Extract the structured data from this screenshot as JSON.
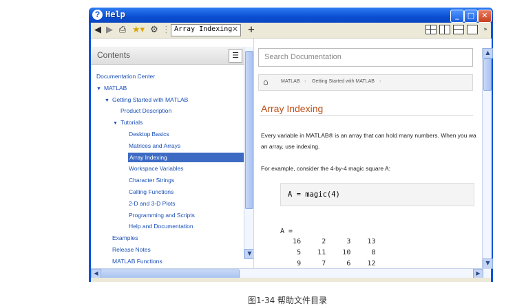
{
  "window": {
    "title": "Help",
    "title_icon": "?",
    "controls": {
      "minimize": "_",
      "maximize": "□",
      "close": "✕"
    }
  },
  "toolbar": {
    "tab_label": "Array Indexing",
    "tab_close": "✕",
    "add_tab": "+"
  },
  "contents": {
    "header": "Contents",
    "items": [
      {
        "label": "Documentation Center",
        "level": 0,
        "expanded": false
      },
      {
        "label": "MATLAB",
        "level": 0,
        "expanded": true
      },
      {
        "label": "Getting Started with MATLAB",
        "level": 1,
        "expanded": true
      },
      {
        "label": "Product Description",
        "level": 2
      },
      {
        "label": "Tutorials",
        "level": 2,
        "expanded": true
      },
      {
        "label": "Desktop Basics",
        "level": 3
      },
      {
        "label": "Matrices and Arrays",
        "level": 3
      },
      {
        "label": "Array Indexing",
        "level": 3,
        "selected": true
      },
      {
        "label": "Workspace Variables",
        "level": 3
      },
      {
        "label": "Character Strings",
        "level": 3
      },
      {
        "label": "Calling Functions",
        "level": 3
      },
      {
        "label": "2-D and 3-D Plots",
        "level": 3
      },
      {
        "label": "Programming and Scripts",
        "level": 3
      },
      {
        "label": "Help and Documentation",
        "level": 3
      },
      {
        "label": "Examples",
        "level": 1
      },
      {
        "label": "Release Notes",
        "level": 1
      },
      {
        "label": "MATLAB Functions",
        "level": 1
      }
    ]
  },
  "doc": {
    "search_placeholder": "Search Documentation",
    "breadcrumb": [
      "MATLAB",
      "Getting Started with MATLAB"
    ],
    "title": "Array Indexing",
    "para1_line1": "Every variable in MATLAB® is an array that can hold many numbers. When you wa",
    "para1_line2": "an array, use indexing.",
    "para2": "For example, consider the 4-by-4 magic square A:",
    "code": "A = magic(4)",
    "output_label": "A =",
    "output_rows": [
      "   16     2     3    13",
      "    5    11    10     8",
      "    9     7     6    12"
    ]
  },
  "caption": "图1-34 帮助文件目录"
}
